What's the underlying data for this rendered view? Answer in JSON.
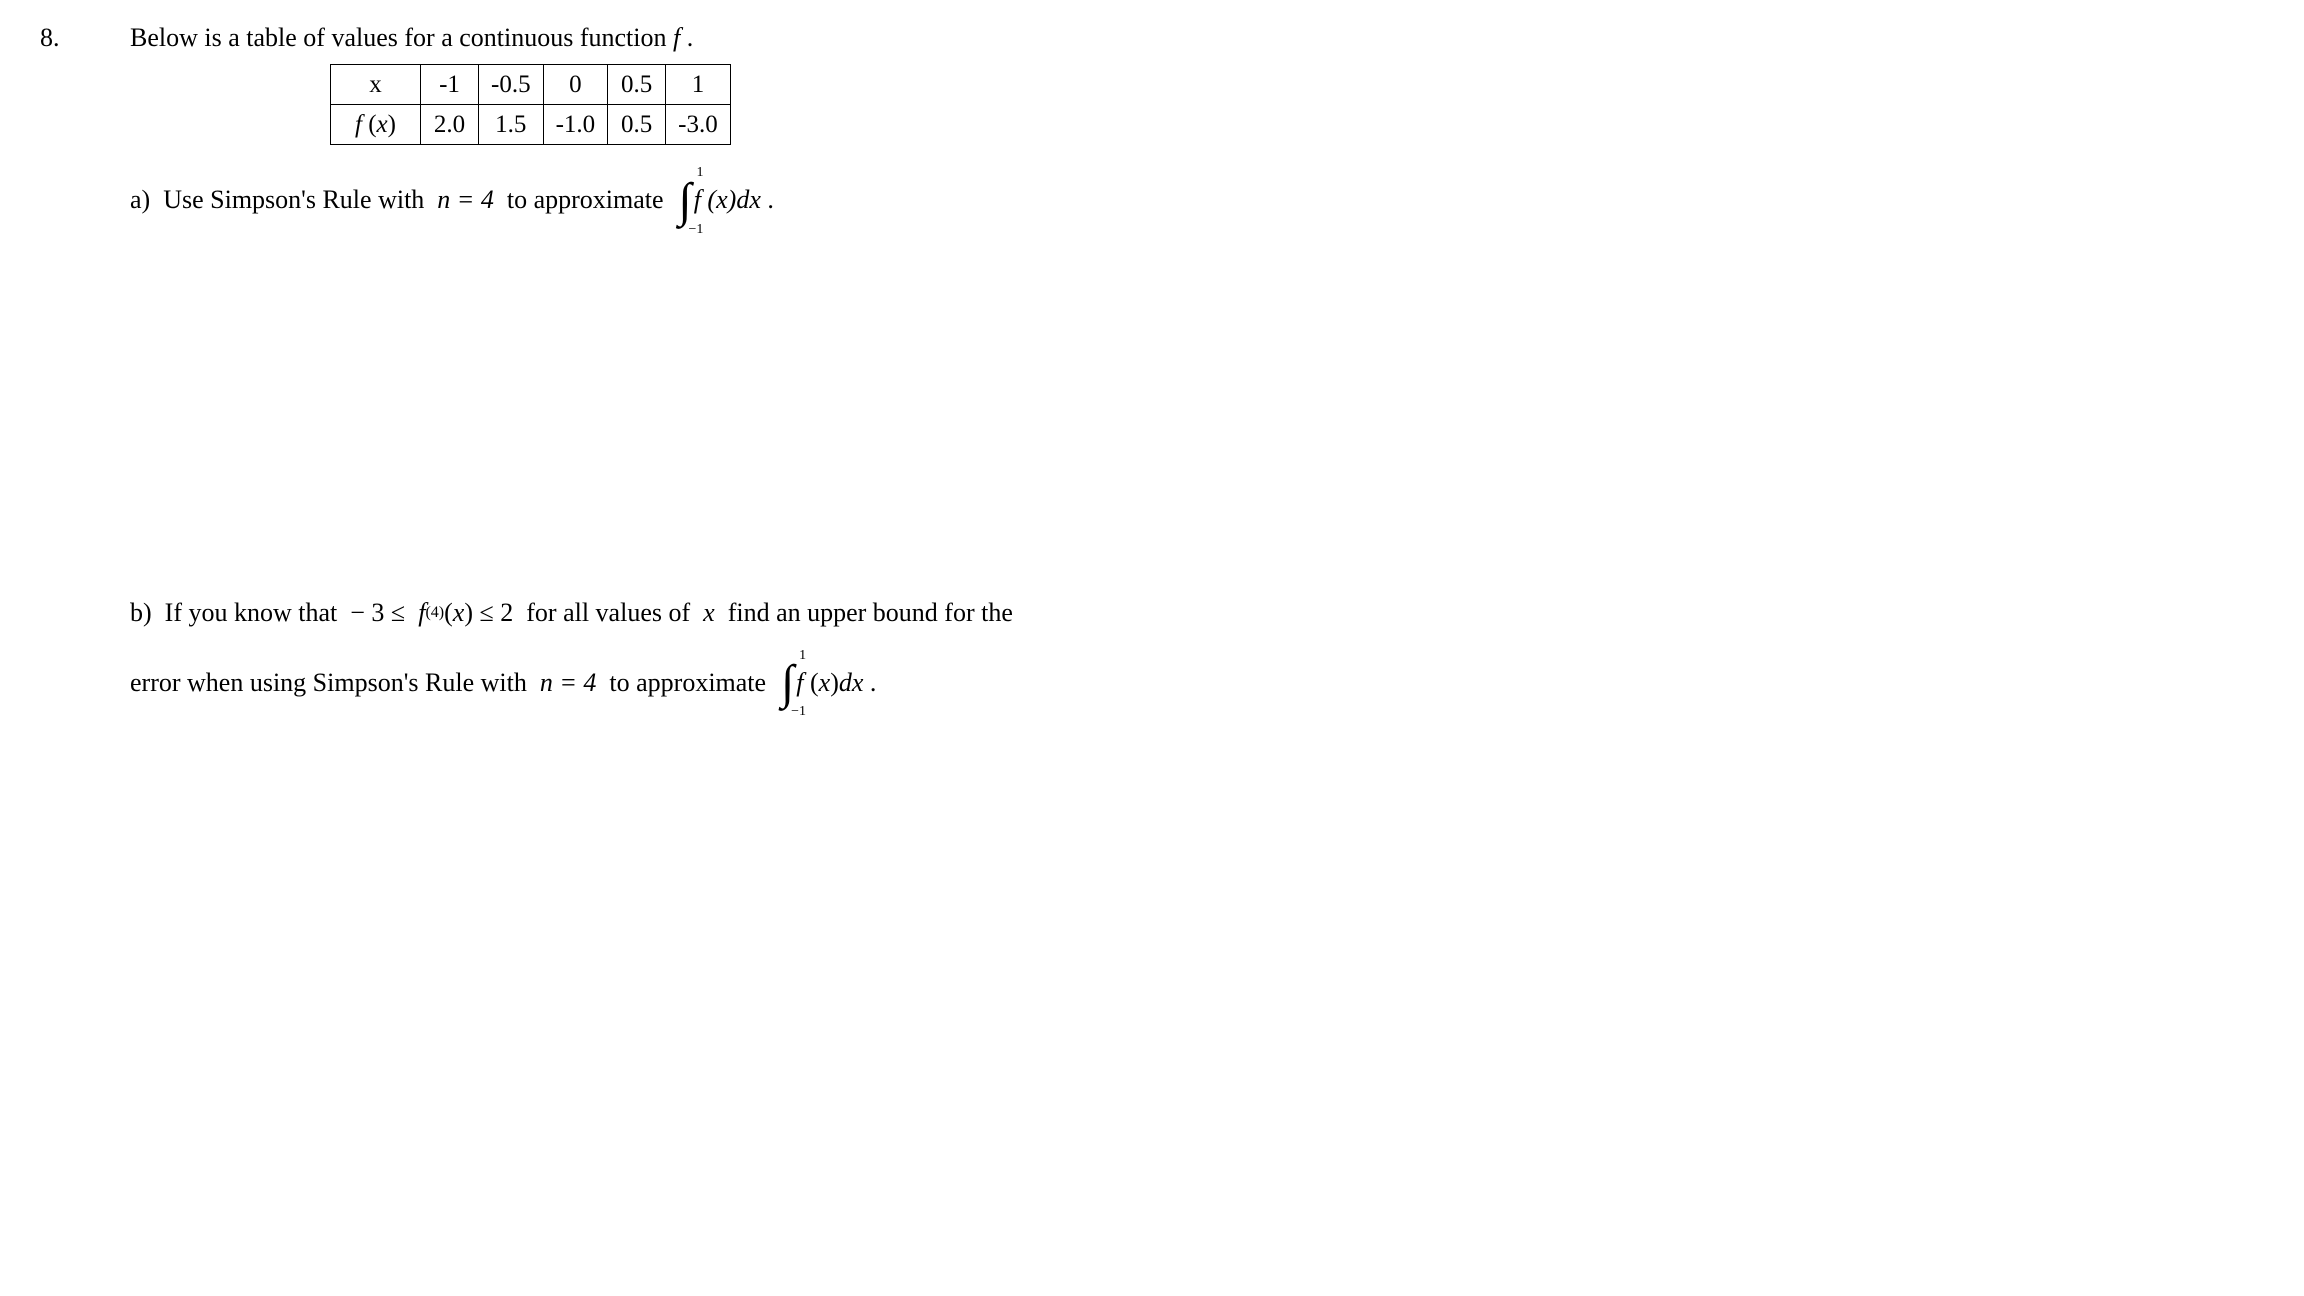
{
  "problem_number": "8.",
  "intro": "Below is a table of values for a continuous function  f .",
  "table": {
    "row1_label": "x",
    "row1": [
      "-1",
      "-0.5",
      "0",
      "0.5",
      "1"
    ],
    "row2_label": "f (x)",
    "row2": [
      "2.0",
      "1.5",
      "-1.0",
      "0.5",
      "-3.0"
    ]
  },
  "part_a": {
    "label": "a)",
    "text1": "  Use Simpson's Rule with  ",
    "n_eq": "n = 4",
    "text2": "  to approximate  ",
    "integral_upper": "1",
    "integral_lower": "−1",
    "integrand": "f (x)dx",
    "period": " ."
  },
  "part_b": {
    "label": "b)",
    "text1": "  If you know that  ",
    "bound": "− 3 ≤  f",
    "sup": "(4)",
    "bound2": "(x) ≤ 2",
    "text2": "  for all values of  x  find an upper bound for the",
    "text3": "error when using Simpson's Rule with  ",
    "n_eq": "n = 4",
    "text4": "  to approximate  ",
    "integral_upper": "1",
    "integral_lower": "−1",
    "integrand": "f (x)dx",
    "period": " ."
  }
}
